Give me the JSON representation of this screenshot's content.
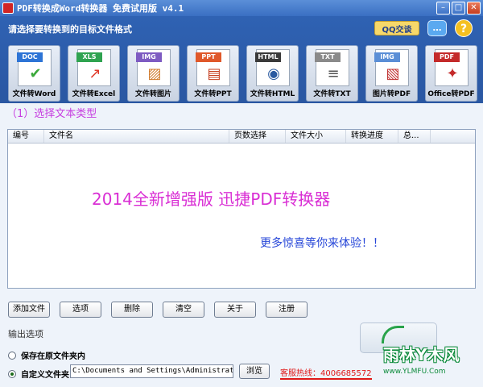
{
  "window": {
    "title": "PDF转换成Word转换器 免费试用版 v4.1",
    "minimize": "–",
    "maximize": "□",
    "close": "✕"
  },
  "header": {
    "prompt": "请选择要转换到的目标文件格式",
    "qq_label": "QQ交谈",
    "chat_glyph": "…",
    "help_glyph": "?"
  },
  "tools": [
    {
      "tag": "DOC",
      "tag_color": "#2d74d6",
      "glyph": "✔",
      "glyph_color": "#3aa83a",
      "label": "文件转Word"
    },
    {
      "tag": "XLS",
      "tag_color": "#2fa350",
      "glyph": "↗",
      "glyph_color": "#e03a2a",
      "label": "文件转Excel"
    },
    {
      "tag": "IMG",
      "tag_color": "#7e5bc2",
      "glyph": "▨",
      "glyph_color": "#d07a2a",
      "label": "文件转图片"
    },
    {
      "tag": "PPT",
      "tag_color": "#e0582a",
      "glyph": "▤",
      "glyph_color": "#c43a1a",
      "label": "文件转PPT"
    },
    {
      "tag": "HTML",
      "tag_color": "#3a3a3a",
      "glyph": "◉",
      "glyph_color": "#2a5aa0",
      "label": "文件转HTML"
    },
    {
      "tag": "TXT",
      "tag_color": "#8a8a8a",
      "glyph": "≡",
      "glyph_color": "#555555",
      "label": "文件转TXT"
    },
    {
      "tag": "IMG",
      "tag_color": "#5a8ed6",
      "glyph": "▧",
      "glyph_color": "#c03030",
      "label": "图片转PDF"
    },
    {
      "tag": "PDF",
      "tag_color": "#c42a2a",
      "glyph": "✦",
      "glyph_color": "#c42a2a",
      "label": "Office转PDF"
    }
  ],
  "step_label": "（1）选择文本类型",
  "filelist": {
    "columns": [
      "编号",
      "文件名",
      "页数选择",
      "文件大小",
      "转换进度",
      "总..."
    ],
    "promo_line1": "2014全新增强版   迅捷PDF转换器",
    "promo_line2": "更多惊喜等你来体验！！"
  },
  "actions": [
    "添加文件",
    "选项",
    "删除",
    "清空",
    "关于",
    "注册"
  ],
  "output": {
    "title": "输出选项",
    "option_original": "保存在原文件夹内",
    "option_custom": "自定义文件夹",
    "path_value": "C:\\Documents and Settings\\Administrator\\桌面",
    "browse_label": "浏览",
    "hotline": "客服热线：4006685572"
  },
  "watermark": {
    "main": "雨林Y木风",
    "url": "www.YLMFU.Com"
  }
}
